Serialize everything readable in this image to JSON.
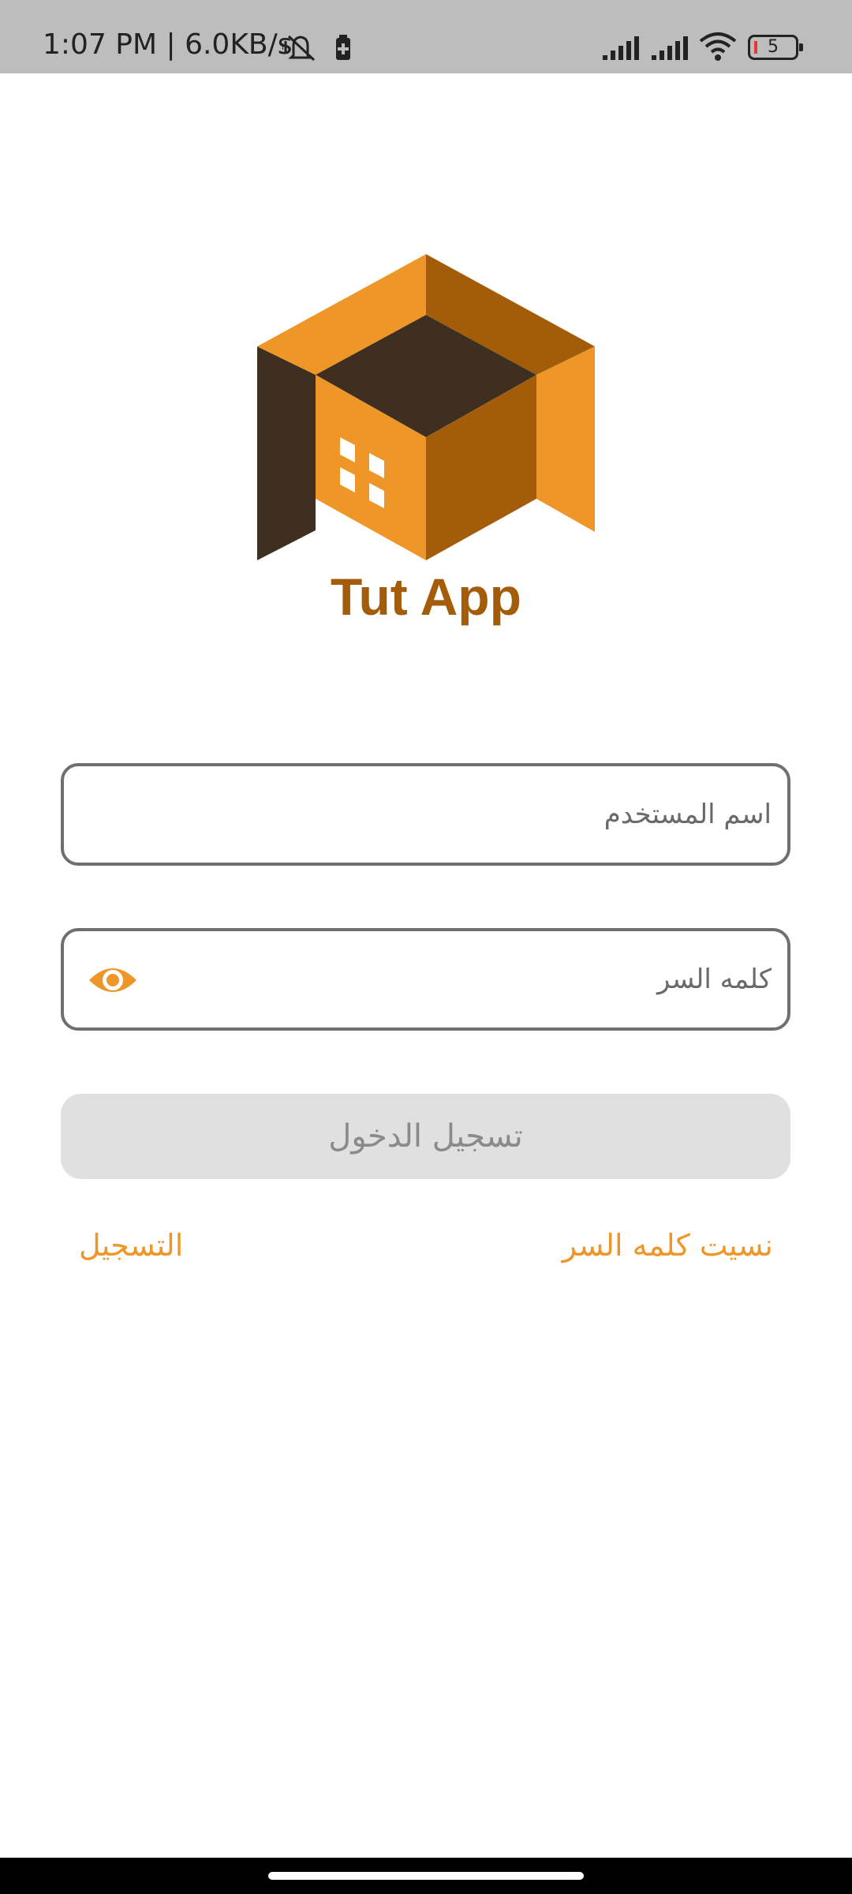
{
  "status_bar": {
    "time": "1:07 PM | 6.0KB/s",
    "battery_level": "5",
    "icons": [
      "mute-icon",
      "battery-saver-icon",
      "signal-icon",
      "signal-icon",
      "wifi-icon",
      "battery-icon"
    ]
  },
  "app": {
    "name": "Tut App",
    "logo": "house-cube-logo"
  },
  "login_form": {
    "username_placeholder": "اسم المستخدم",
    "password_placeholder": "كلمه السر",
    "login_button": "تسجيل الدخول",
    "register_link": "التسجيل",
    "forgot_password_link": "نسيت كلمه السر"
  },
  "colors": {
    "accent": "#ee9628",
    "brand_dark": "#a35d0a",
    "logo_dark": "#3f2f20",
    "disabled_button": "#e0e0e0"
  }
}
